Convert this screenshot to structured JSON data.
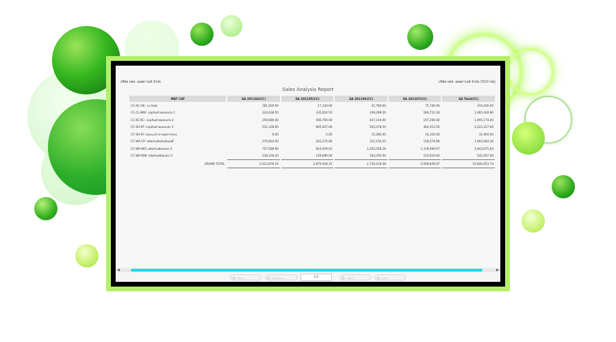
{
  "report": {
    "company_left": "บริษัท ปตท. ออลคาวนท์ จำกัด",
    "company_right": "บริษัท ปตท. ออลคาวนท์ จำกัด (TEST-HQ)",
    "title": "Sales Analysis Report",
    "columns": [
      "MAT CAT",
      "SA 201104(CC)",
      "SA 201105(CC)",
      "SA 201106(CC)",
      "SA 201107(CC)",
      "SA Total(CC)"
    ],
    "rows": [
      {
        "cat": "CC-AC-GE: รถ Auto",
        "v1": "181,560.00",
        "v2": "17,140.00",
        "v3": "41,760.00",
        "v4": "75,740.00",
        "total": "316,200.00"
      },
      {
        "cat": "CC-CL-WW: กลุ่มสินค้าทดสอบส่ง 1",
        "v1": "334,438.50",
        "v2": "335,002.50",
        "v3": "249,289.50",
        "v4": "166,710.30",
        "total": "1,085,440.80"
      },
      {
        "cat": "CC-KC-KC: กลุ่มสินค้าทดสอบส่ง 2",
        "v1": "259,980.00",
        "v2": "590,700.00",
        "v3": "447,144.00",
        "v4": "197,290.00",
        "total": "1,495,174.00"
      },
      {
        "cat": "CC-SH-KT: กลุ่มสินค้าทดสอบส่ง 3",
        "v1": "531,328.00",
        "v2": "665,007.00",
        "v3": "563,478.50",
        "v4": "462,413.50",
        "total": "2,222,227.00"
      },
      {
        "cat": "CC-SH-SF: ผลแนะนำขายอุตสาหร่อง",
        "v1": "0.00",
        "v2": "0.00",
        "v3": "15,284.00",
        "v4": "16,320.00",
        "total": "31,604.00"
      },
      {
        "cat": "CC-WA-CP: ผลิตภัณฑ์หลักสัมฤทธิ์",
        "v1": "270,664.50",
        "v2": "262,270.80",
        "v3": "312,154.20",
        "v4": "158,374.80",
        "total": "1,003,464.30"
      },
      {
        "cat": "CC-WA-WO: ผลิตภัณฑ์ทดสอบ 4",
        "v1": "707,588.96",
        "v2": "854,059.03",
        "v3": "1,003,058.18",
        "v4": "1,378,969.67",
        "total": "3,943,675.84"
      },
      {
        "cat": "CC-WA-WW: ผลิตภัณฑ์ทดสอบ 5",
        "v1": "138,318.20",
        "v2": "149,689.00",
        "v3": "104,250.00",
        "v4": "153,610.60",
        "total": "542,267.60"
      }
    ],
    "grand_total": {
      "label": "GRAND TOTAL",
      "v1": "2,423,878.16",
      "v2": "2,870,928.33",
      "v3": "2,736,418.38",
      "v4": "2,608,828.87",
      "total": "10,640,053.74"
    }
  },
  "pager": {
    "first": "First",
    "previous": "Previous",
    "page": "1/1",
    "next": "Next",
    "last": "Last"
  },
  "colors": {
    "frame": "#b5ef6a",
    "scroll_thumb": "#24d6e6",
    "header_bg": "#dadada"
  }
}
